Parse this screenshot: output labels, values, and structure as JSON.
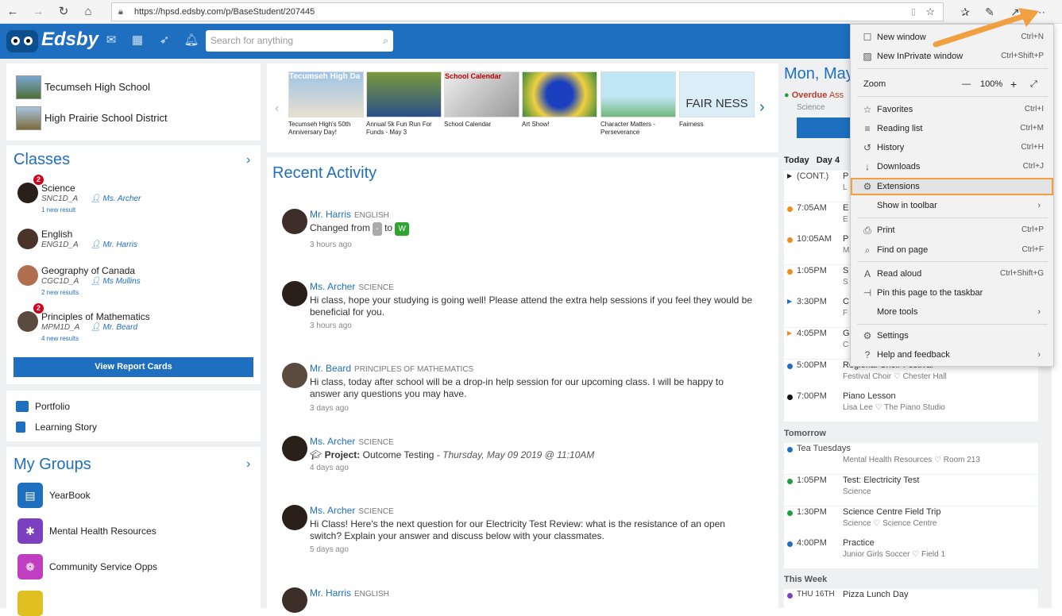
{
  "browser": {
    "url": "https://hpsd.edsby.com/p/BaseStudent/207445"
  },
  "app": {
    "logo": "Edsby",
    "search_placeholder": "Search for anything"
  },
  "schools": [
    {
      "name": "Tecumseh High School"
    },
    {
      "name": "High Prairie School District"
    }
  ],
  "classes": {
    "title": "Classes",
    "items": [
      {
        "name": "Science",
        "code": "SNC1D_A",
        "teacher": "Ms. Archer",
        "results": "1 new result",
        "badge": "2"
      },
      {
        "name": "English",
        "code": "ENG1D_A",
        "teacher": "Mr. Harris",
        "results": "",
        "badge": ""
      },
      {
        "name": "Geography of Canada",
        "code": "CGC1D_A",
        "teacher": "Ms Mullins",
        "results": "2 new results",
        "badge": ""
      },
      {
        "name": "Principles of Mathematics",
        "code": "MPM1D_A",
        "teacher": "Mr. Beard",
        "results": "4 new results",
        "badge": "2"
      }
    ],
    "report_button": "View Report Cards"
  },
  "links": {
    "portfolio": "Portfolio",
    "learning_story": "Learning Story"
  },
  "groups": {
    "title": "My Groups",
    "items": [
      {
        "name": "YearBook",
        "color": "#1e6fbf"
      },
      {
        "name": "Mental Health Resources",
        "color": "#7b3fbf"
      },
      {
        "name": "Community Service Opps",
        "color": "#c03fc0"
      }
    ]
  },
  "carousel": [
    {
      "caption": "Tecumseh High's 50th Anniversary Day!",
      "overlay": "Tecumseh High Da"
    },
    {
      "caption": "Annual 5k Fun Run For Funds - May 3",
      "overlay": ""
    },
    {
      "caption": "School Calendar",
      "overlay": "School Calendar"
    },
    {
      "caption": "Art Show!",
      "overlay": ""
    },
    {
      "caption": "Character Matters - Perseverance",
      "overlay": ""
    },
    {
      "caption": "Fairness",
      "overlay": "FAIR NESS"
    }
  ],
  "recent": {
    "title": "Recent Activity",
    "items": [
      {
        "who": "Mr. Harris",
        "subject": "ENGLISH",
        "text_pre": "Changed from",
        "from_tag": "-",
        "to_word": "to",
        "to_tag": "W",
        "time": "3 hours ago"
      },
      {
        "who": "Ms. Archer",
        "subject": "SCIENCE",
        "text": "Hi class, hope your studying is going well! Please attend the extra help sessions if you feel they would be beneficial for you.",
        "time": "3 hours ago"
      },
      {
        "who": "Mr. Beard",
        "subject": "PRINCIPLES OF MATHEMATICS",
        "text": "Hi class, today after school will be a drop-in help session for our upcoming class. I will be happy to answer any questions you may have.",
        "time": "3 days ago"
      },
      {
        "who": "Ms. Archer",
        "subject": "SCIENCE",
        "project_label": "Project:",
        "project_name": "Outcome Testing",
        "project_date": "- Thursday, May 09 2019 @ 11:10AM",
        "time": "4 days ago"
      },
      {
        "who": "Ms. Archer",
        "subject": "SCIENCE",
        "text": "Hi Class! Here's the next question for our Electricity Test Review: what is the resistance of an open switch? Explain your answer and discuss below with your classmates.",
        "time": "5 days ago"
      },
      {
        "who": "Mr. Harris",
        "subject": "ENGLISH"
      }
    ]
  },
  "calendar": {
    "date_title": "Mon, May",
    "overdue_label": "Overdue",
    "overdue_item": "Ass",
    "overdue_subject": "Science",
    "today": "Today",
    "day": "Day 4",
    "today_events": [
      {
        "time": "(CONT.)",
        "name": "P",
        "detail": "L",
        "dot": "#222",
        "arrow": true
      },
      {
        "time": "7:05AM",
        "name": "E",
        "detail": "E",
        "dot": "#f08c1e"
      },
      {
        "time": "10:05AM",
        "name": "P",
        "detail": "M",
        "dot": "#f08c1e"
      },
      {
        "time": "1:05PM",
        "name": "S",
        "detail": "S",
        "dot": "#f08c1e"
      },
      {
        "time": "3:30PM",
        "name": "C",
        "detail": "F",
        "dot": "#1e6fbf",
        "arrow": true
      },
      {
        "time": "4:05PM",
        "name": "G",
        "detail": "C",
        "dot": "#f08c1e",
        "arrow": true
      },
      {
        "time": "5:00PM",
        "name": "Regional Choir Festival",
        "detail": "Festival Choir ♡ Chester Hall",
        "dot": "#1e6fbf"
      },
      {
        "time": "7:00PM",
        "name": "Piano Lesson",
        "detail": "Lisa Lee ♡ The Piano Studio",
        "dot": "#111"
      }
    ],
    "tomorrow": "Tomorrow",
    "tomorrow_events": [
      {
        "time": "Tea Tuesdays",
        "name": "",
        "detail": "Mental Health Resources ♡ Room 213",
        "dot": "#1e6fbf"
      },
      {
        "time": "1:05PM",
        "name": "Test: Electricity Test",
        "detail": "Science",
        "dot": "#1e9e3e"
      },
      {
        "time": "1:30PM",
        "name": "Science Centre Field Trip",
        "detail": "Science ♡ Science Centre",
        "dot": "#1e9e3e"
      },
      {
        "time": "4:00PM",
        "name": "Practice",
        "detail": "Junior Girls Soccer ♡ Field 1",
        "dot": "#1e6fbf"
      }
    ],
    "this_week": "This Week",
    "week_event": {
      "time": "THU 16TH",
      "name": "Pizza Lunch Day"
    }
  },
  "menu": {
    "items": [
      {
        "icon": "☐",
        "label": "New window",
        "shortcut": "Ctrl+N"
      },
      {
        "icon": "▨",
        "label": "New InPrivate window",
        "shortcut": "Ctrl+Shift+P"
      },
      {
        "label": "Zoom",
        "zoom": "100%"
      },
      {
        "icon": "☆",
        "label": "Favorites",
        "shortcut": "Ctrl+I"
      },
      {
        "icon": "≡",
        "label": "Reading list",
        "shortcut": "Ctrl+M"
      },
      {
        "icon": "↺",
        "label": "History",
        "shortcut": "Ctrl+H"
      },
      {
        "icon": "↓",
        "label": "Downloads",
        "shortcut": "Ctrl+J"
      },
      {
        "icon": "⚙",
        "label": "Extensions",
        "shortcut": ""
      },
      {
        "label": "Show in toolbar",
        "arrow": "›"
      },
      {
        "icon": "⎙",
        "label": "Print",
        "shortcut": "Ctrl+P"
      },
      {
        "icon": "⌕",
        "label": "Find on page",
        "shortcut": "Ctrl+F"
      },
      {
        "icon": "A",
        "label": "Read aloud",
        "shortcut": "Ctrl+Shift+G"
      },
      {
        "icon": "⊣",
        "label": "Pin this page to the taskbar",
        "shortcut": ""
      },
      {
        "label": "More tools",
        "arrow": "›"
      },
      {
        "icon": "⚙",
        "label": "Settings",
        "shortcut": ""
      },
      {
        "icon": "?",
        "label": "Help and feedback",
        "arrow": "›"
      }
    ]
  },
  "colors": {
    "brand": "#1e6fbf",
    "highlight": "#f0a040"
  }
}
